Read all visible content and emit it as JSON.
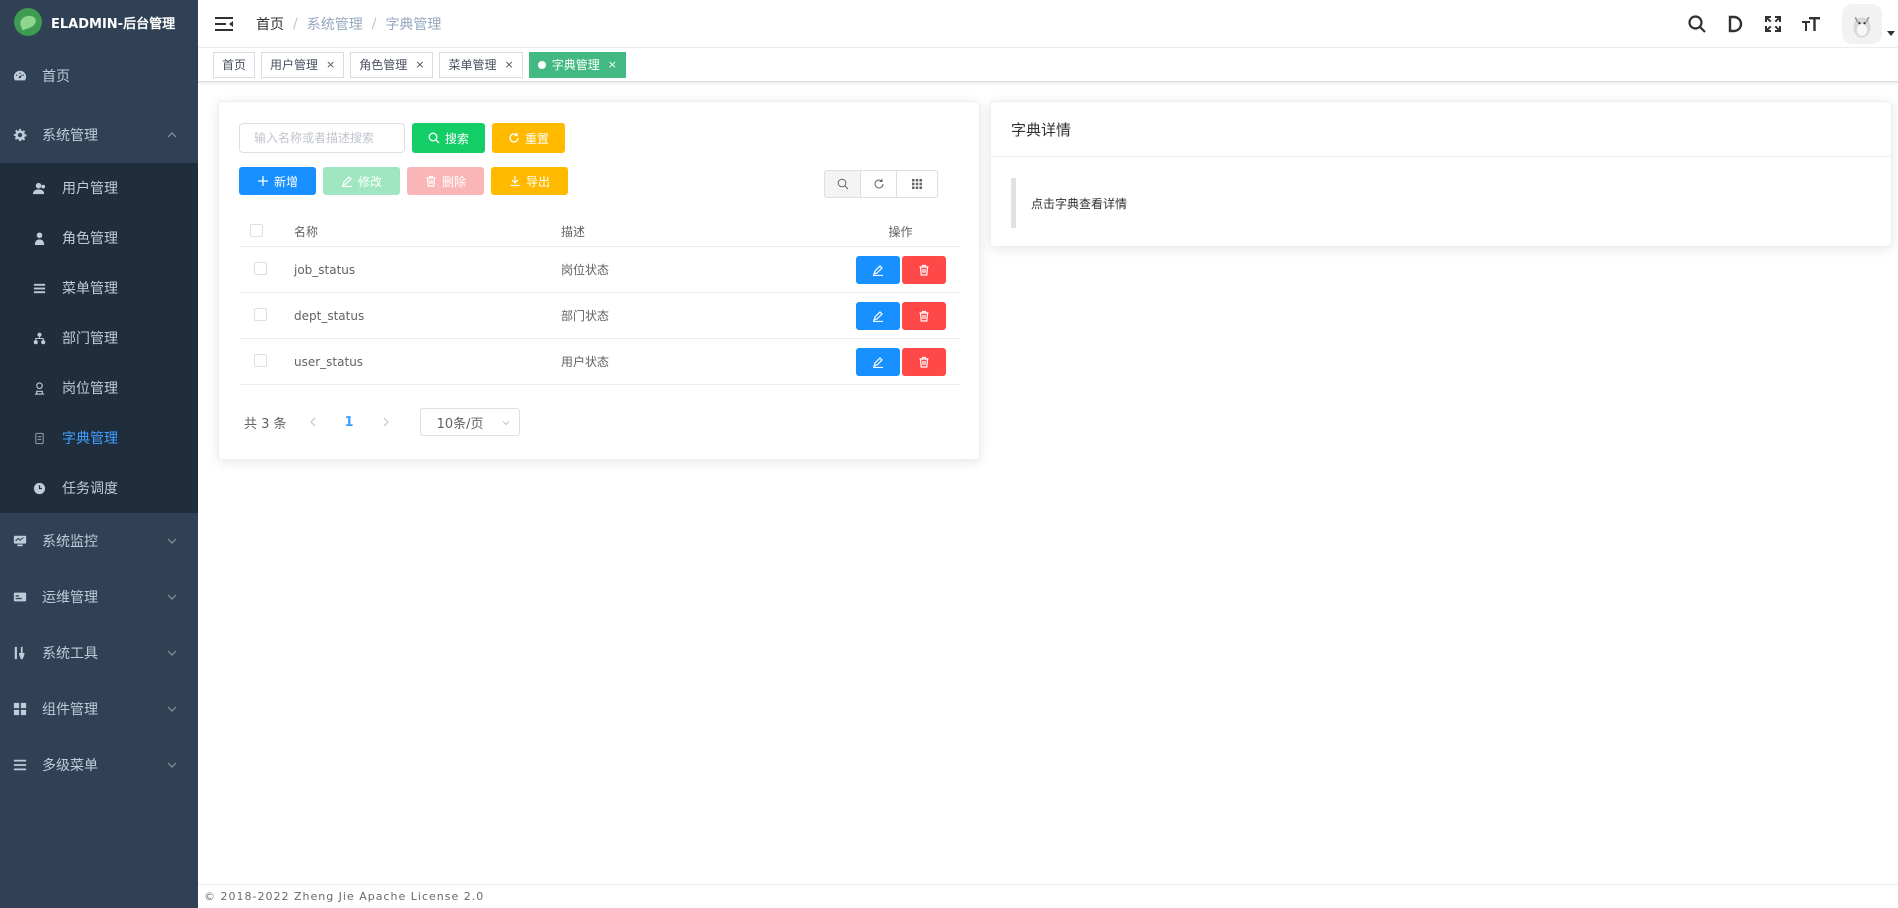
{
  "app": {
    "logo_title": "ELADMIN-后台管理"
  },
  "sidebar": {
    "home": {
      "label": "首页",
      "icon": "dashboard-icon"
    },
    "system": {
      "label": "系统管理",
      "icon": "gear-icon",
      "expanded": true,
      "items": [
        {
          "label": "用户管理",
          "icon": "users-icon"
        },
        {
          "label": "角色管理",
          "icon": "role-icon"
        },
        {
          "label": "菜单管理",
          "icon": "menu-icon"
        },
        {
          "label": "部门管理",
          "icon": "dept-icon"
        },
        {
          "label": "岗位管理",
          "icon": "post-icon"
        },
        {
          "label": "字典管理",
          "icon": "dictionary-icon",
          "active": true
        },
        {
          "label": "任务调度",
          "icon": "timer-icon"
        }
      ]
    },
    "collapsed": [
      {
        "label": "系统监控",
        "icon": "monitor-icon"
      },
      {
        "label": "运维管理",
        "icon": "ops-icon"
      },
      {
        "label": "系统工具",
        "icon": "tools-icon"
      },
      {
        "label": "组件管理",
        "icon": "components-icon"
      },
      {
        "label": "多级菜单",
        "icon": "list-icon"
      }
    ]
  },
  "navbar": {
    "breadcrumb": [
      "首页",
      "系统管理",
      "字典管理"
    ],
    "separator": "/"
  },
  "tags": [
    {
      "label": "首页",
      "closable": false
    },
    {
      "label": "用户管理",
      "closable": true
    },
    {
      "label": "角色管理",
      "closable": true
    },
    {
      "label": "菜单管理",
      "closable": true
    },
    {
      "label": "字典管理",
      "closable": true,
      "active": true
    }
  ],
  "tag_close": "×",
  "search": {
    "placeholder": "输入名称或者描述搜索",
    "value": "",
    "search_label": "搜索",
    "reset_label": "重置"
  },
  "crud": {
    "add": "新增",
    "edit": "修改",
    "delete": "删除",
    "export": "导出"
  },
  "table": {
    "headers": {
      "name": "名称",
      "desc": "描述",
      "op": "操作"
    },
    "rows": [
      {
        "name": "job_status",
        "desc": "岗位状态"
      },
      {
        "name": "dept_status",
        "desc": "部门状态"
      },
      {
        "name": "user_status",
        "desc": "用户状态"
      }
    ]
  },
  "pagination": {
    "total_text": "共 3 条",
    "current_page": "1",
    "page_size": "10条/页"
  },
  "detail": {
    "title": "字典详情",
    "tip": "点击字典查看详情"
  },
  "footer": {
    "text": "© 2018-2022 Zheng Jie Apache License 2.0"
  },
  "colors": {
    "sidebar_bg": "#304156",
    "submenu_bg": "#1f2d3d",
    "active_menu": "#409eff",
    "active_tag": "#42b983",
    "primary": "#1890ff",
    "success": "#13ce66",
    "warning": "#ffba00",
    "danger": "#ff4949"
  }
}
